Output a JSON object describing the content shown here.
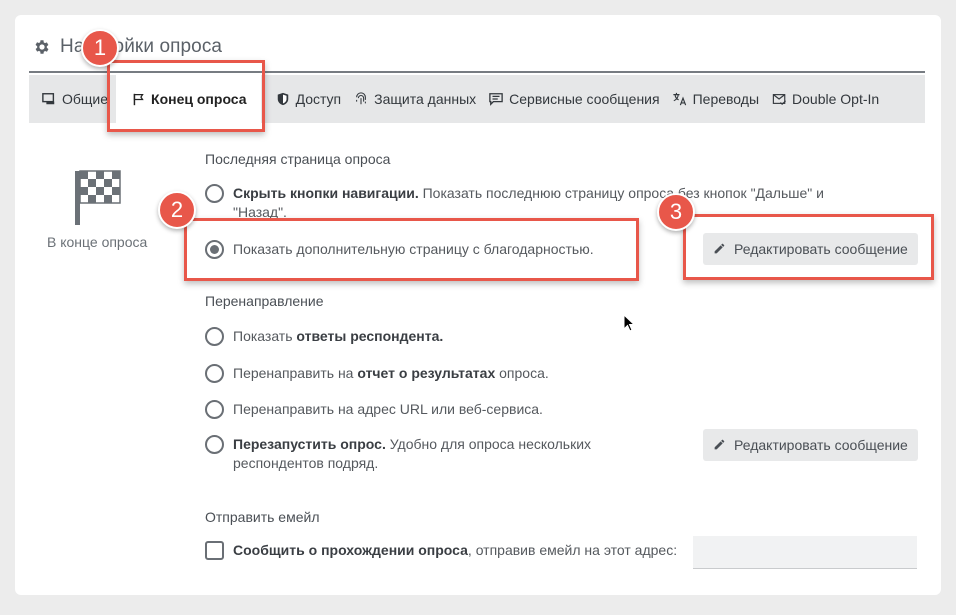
{
  "header": {
    "title": "Настройки опроса",
    "icon": "gear-icon"
  },
  "tabs": [
    {
      "label": "Общие",
      "icon": "monitor-icon"
    },
    {
      "label": "Конец опроса",
      "icon": "flag-icon",
      "active": true
    },
    {
      "label": "Доступ",
      "icon": "shield-icon"
    },
    {
      "label": "Защита данных",
      "icon": "fingerprint-icon"
    },
    {
      "label": "Сервисные сообщения",
      "icon": "message-icon"
    },
    {
      "label": "Переводы",
      "icon": "translate-icon"
    },
    {
      "label": "Double Opt-In",
      "icon": "mail-check-icon"
    }
  ],
  "sidebar": {
    "label": "В конце опроса",
    "icon": "checkered-flag-icon"
  },
  "last_page": {
    "title": "Последняя страница опроса",
    "hide_nav": {
      "bold": "Скрыть кнопки навигации.",
      "rest": " Показать последнюю страницу опроса без кнопок \"Дальше\" и \"Назад\"."
    },
    "thanks": {
      "label": "Показать дополнительную страницу с благодарностью."
    },
    "edit_button": "Редактировать сообщение"
  },
  "redirect": {
    "title": "Перенаправление",
    "show_answers": {
      "pre": "Показать ",
      "bold": "ответы респондента."
    },
    "to_report": {
      "pre": "Перенаправить на ",
      "bold": "отчет о результатах",
      "post": " опроса."
    },
    "to_url": {
      "label": "Перенаправить на адрес URL или веб-сервиса."
    },
    "restart": {
      "bold": "Перезапустить опрос.",
      "rest": " Удобно для опроса нескольких респондентов подряд."
    },
    "edit_button": "Редактировать сообщение"
  },
  "email": {
    "title": "Отправить емейл",
    "notify": {
      "bold": "Сообщить о прохождении опроса",
      "rest": ", отправив емейл на этот адрес:"
    },
    "value": ""
  },
  "annotations": {
    "b1": "1",
    "b2": "2",
    "b3": "3"
  },
  "colors": {
    "highlight": "#e8574a",
    "tab_bar": "#e6e7e8",
    "background": "#ececec"
  }
}
